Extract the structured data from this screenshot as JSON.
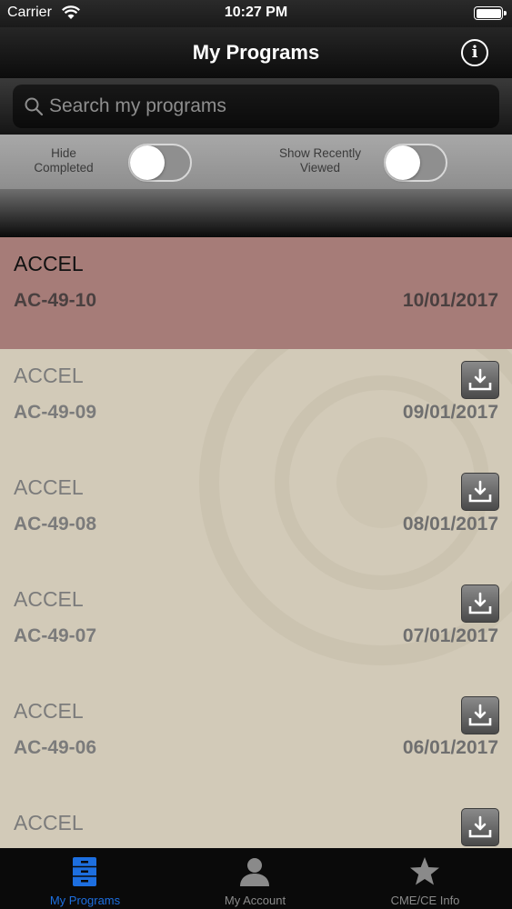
{
  "status_bar": {
    "carrier": "Carrier",
    "time": "10:27 PM"
  },
  "nav": {
    "title": "My Programs",
    "info_icon": "info-icon"
  },
  "search": {
    "placeholder": "Search my programs",
    "value": ""
  },
  "filters": {
    "hide_completed": {
      "label_line1": "Hide",
      "label_line2": "Completed",
      "on": false
    },
    "show_recent": {
      "label_line1": "Show Recently",
      "label_line2": "Viewed",
      "on": false
    }
  },
  "programs": [
    {
      "title": "ACCEL",
      "code": "AC-49-10",
      "date": "10/01/2017",
      "selected": true,
      "downloadable": false
    },
    {
      "title": "ACCEL",
      "code": "AC-49-09",
      "date": "09/01/2017",
      "selected": false,
      "downloadable": true
    },
    {
      "title": "ACCEL",
      "code": "AC-49-08",
      "date": "08/01/2017",
      "selected": false,
      "downloadable": true
    },
    {
      "title": "ACCEL",
      "code": "AC-49-07",
      "date": "07/01/2017",
      "selected": false,
      "downloadable": true
    },
    {
      "title": "ACCEL",
      "code": "AC-49-06",
      "date": "06/01/2017",
      "selected": false,
      "downloadable": true
    },
    {
      "title": "ACCEL",
      "code": "",
      "date": "",
      "selected": false,
      "downloadable": true
    }
  ],
  "tabs": [
    {
      "label": "My Programs",
      "icon": "file-cabinet-icon",
      "active": true
    },
    {
      "label": "My Account",
      "icon": "person-icon",
      "active": false
    },
    {
      "label": "CME/CE Info",
      "icon": "star-icon",
      "active": false
    }
  ],
  "colors": {
    "accent": "#1d6fe0",
    "selected_row": "#a67c78",
    "list_background": "#d2cab8"
  }
}
